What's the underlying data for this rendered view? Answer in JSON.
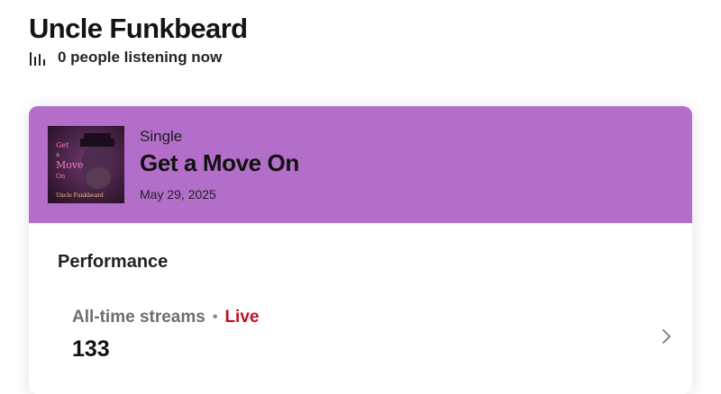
{
  "artist": {
    "name": "Uncle Funkbeard",
    "listening_text": "0 people listening now"
  },
  "release": {
    "type": "Single",
    "title": "Get a Move On",
    "date": "May 29, 2025",
    "cover": {
      "line1": "Get",
      "line2": "a",
      "line3": "Move",
      "line4": "On",
      "credit": "Uncle Funkbeard"
    }
  },
  "performance": {
    "title": "Performance",
    "stat_label": "All-time streams",
    "separator": "•",
    "live_label": "Live",
    "stat_value": "133"
  },
  "colors": {
    "header_bg": "#b36ec9",
    "live": "#c2101d"
  }
}
